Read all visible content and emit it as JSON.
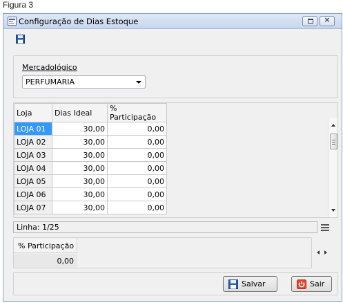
{
  "figure_caption": "Figura 3",
  "window": {
    "title": "Configuração de Dias Estoque"
  },
  "icons": {
    "app": "app-window-icon",
    "save": "floppy-disk-icon",
    "exit": "power-icon",
    "menu": "hamburger-menu-icon"
  },
  "filter": {
    "label": "Mercadológico",
    "selected": "PERFUMARIA"
  },
  "grid": {
    "columns": [
      "Loja",
      "Dias Ideal",
      "% Participação"
    ],
    "rows": [
      {
        "loja": "LOJA 01",
        "dias": "30,00",
        "part": "0,00"
      },
      {
        "loja": "LOJA 02",
        "dias": "30,00",
        "part": "0,00"
      },
      {
        "loja": "LOJA 03",
        "dias": "30,00",
        "part": "0,00"
      },
      {
        "loja": "LOJA 04",
        "dias": "30,00",
        "part": "0,00"
      },
      {
        "loja": "LOJA 05",
        "dias": "30,00",
        "part": "0,00"
      },
      {
        "loja": "LOJA 06",
        "dias": "30,00",
        "part": "0,00"
      },
      {
        "loja": "LOJA 07",
        "dias": "30,00",
        "part": "0,00"
      }
    ]
  },
  "status": {
    "text": "Linha: 1/25"
  },
  "summary": {
    "header": "% Participação",
    "value": "0,00"
  },
  "buttons": {
    "save": "Salvar",
    "exit": "Sair"
  },
  "colors": {
    "selection": "#3399ff",
    "titlebar": "#c7d6ec",
    "exit_icon": "#e8432a"
  }
}
